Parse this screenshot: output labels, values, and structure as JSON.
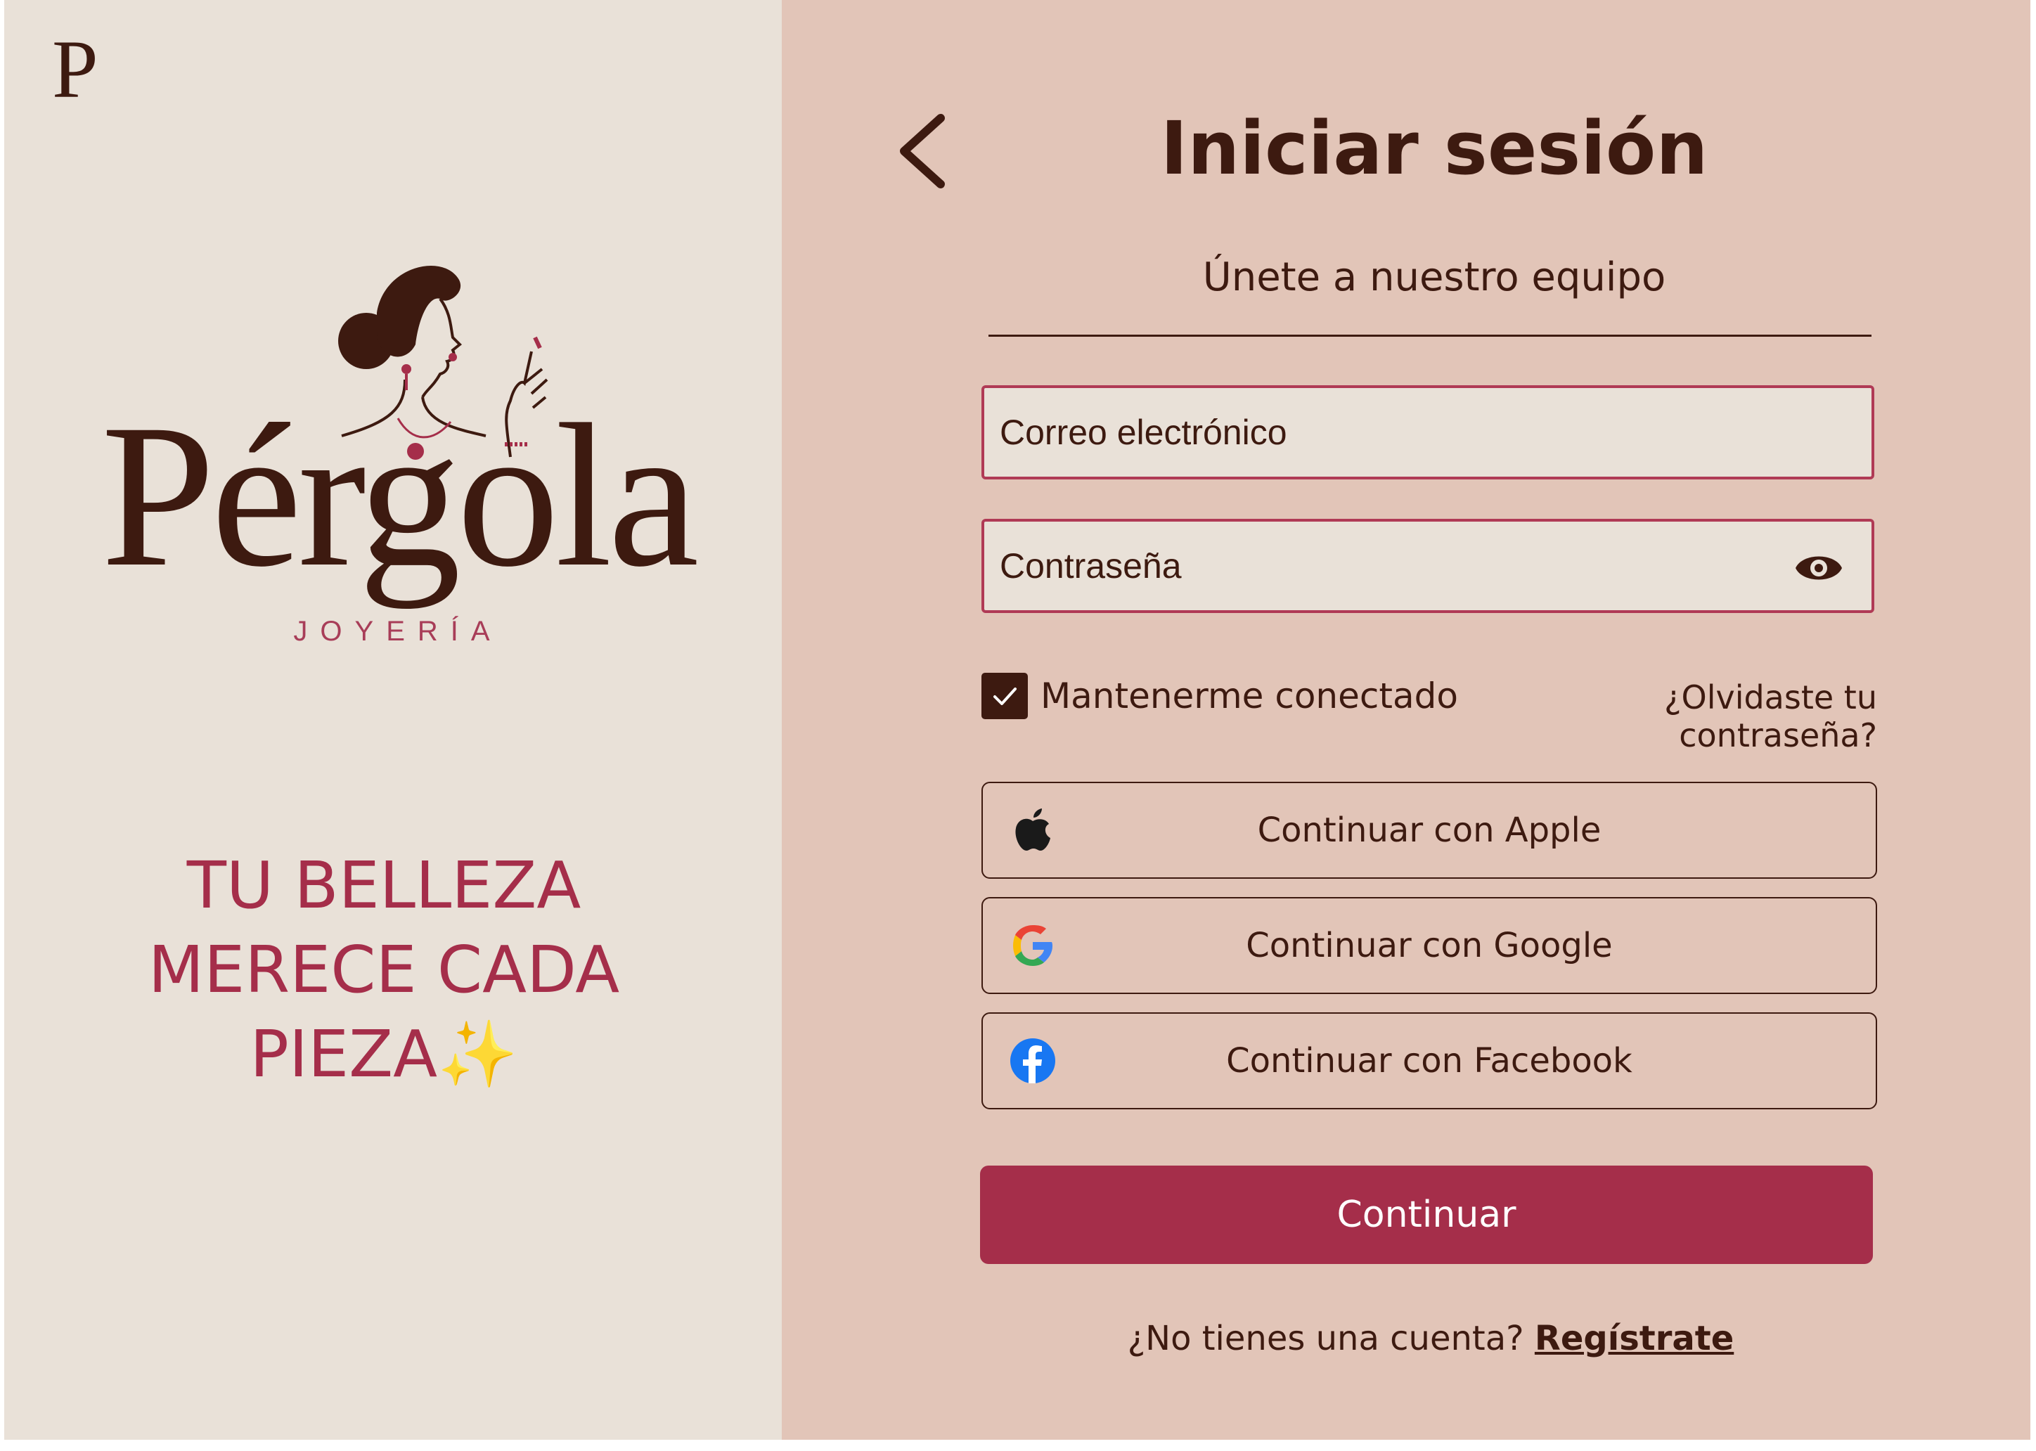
{
  "brand": {
    "corner_mark": "P",
    "name": "Pérgola",
    "subtitle": "JOYERÍA",
    "slogan_lines": [
      "TU BELLEZA",
      "MERECE CADA",
      "PIEZA✨"
    ]
  },
  "login": {
    "back_icon": "chevron-left-icon",
    "title": "Iniciar sesión",
    "subtitle": "Únete a nuestro equipo",
    "email_placeholder": "Correo electrónico",
    "password_placeholder": "Contraseña",
    "password_toggle_icon": "eye-icon",
    "remember_label": "Mantenerme conectado",
    "remember_checked": true,
    "forgot_label": "¿Olvidaste tu contraseña?",
    "social_buttons": [
      {
        "label": "Continuar con Apple",
        "icon": "apple-icon"
      },
      {
        "label": "Continuar con Google",
        "icon": "google-icon"
      },
      {
        "label": "Continuar con Facebook",
        "icon": "facebook-icon"
      }
    ],
    "continue_label": "Continuar",
    "signup_prompt": "¿No tienes una cuenta?",
    "signup_link": "Regístrate"
  },
  "colors": {
    "left_bg": "#e9e1d8",
    "right_bg": "#e2c5b8",
    "brand_dark": "#3d1a10",
    "accent": "#a52e4a"
  }
}
